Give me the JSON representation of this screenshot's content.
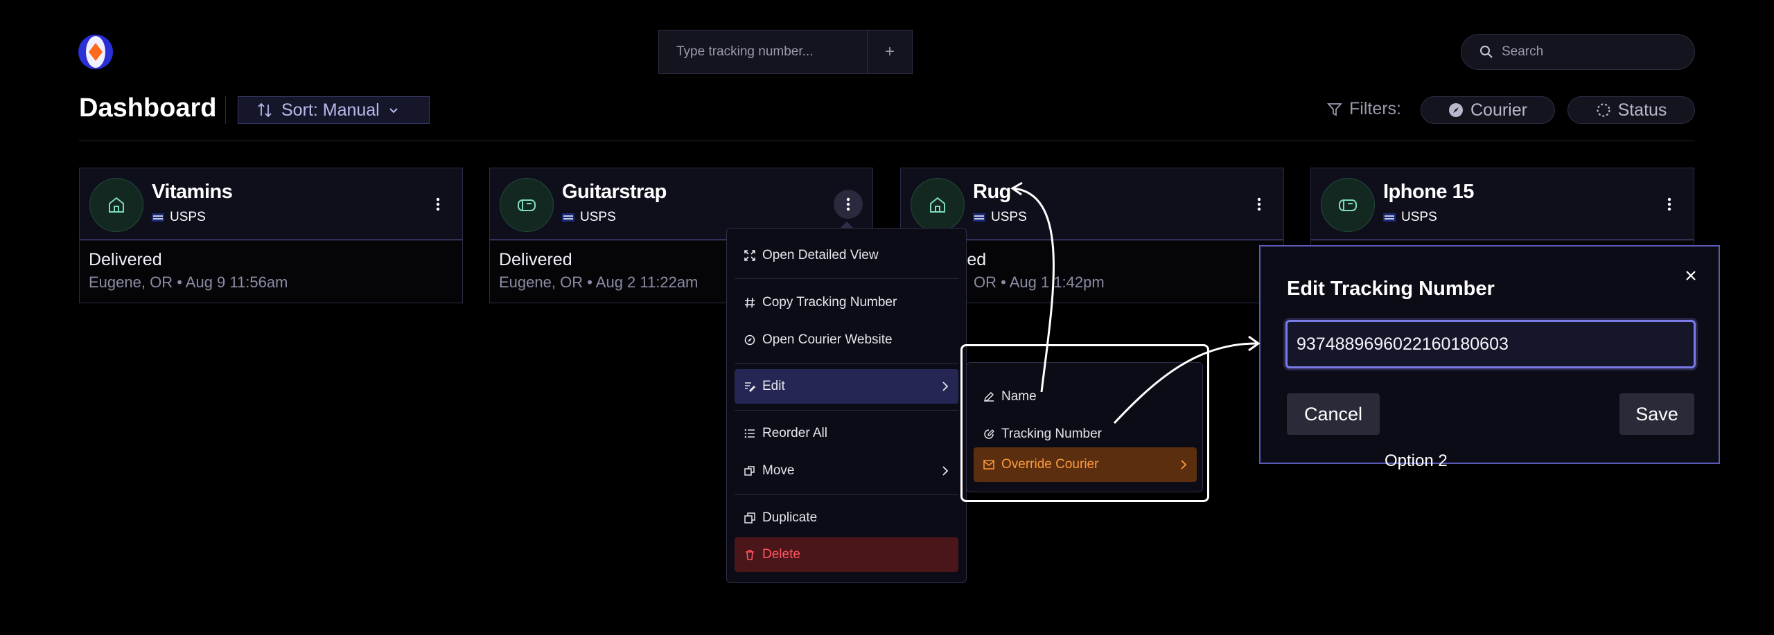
{
  "header": {
    "tracking_placeholder": "Type tracking number...",
    "add_symbol": "+",
    "search_placeholder": "Search"
  },
  "toolbar": {
    "title": "Dashboard",
    "sort_label": "Sort: Manual",
    "filters_label": "Filters:",
    "filter_courier": "Courier",
    "filter_status": "Status"
  },
  "cards": [
    {
      "name": "Vitamins",
      "courier": "USPS",
      "icon": "home-icon",
      "status": "Delivered",
      "location": "Eugene, OR • Aug 9 11:56am"
    },
    {
      "name": "Guitarstrap",
      "courier": "USPS",
      "icon": "mailbox-icon",
      "status": "Delivered",
      "location": "Eugene, OR • Aug 2 11:22am"
    },
    {
      "name": "Rug",
      "courier": "USPS",
      "icon": "home-icon",
      "status": "red",
      "location": "OR • Aug 1 1:42pm"
    },
    {
      "name": "Iphone 15",
      "courier": "USPS",
      "icon": "mailbox-icon",
      "status": "",
      "location": ""
    }
  ],
  "context_menu": {
    "open_detailed_view": "Open Detailed View",
    "copy_tracking_number": "Copy Tracking Number",
    "open_courier_website": "Open Courier Website",
    "edit": "Edit",
    "reorder_all": "Reorder All",
    "move": "Move",
    "duplicate": "Duplicate",
    "delete": "Delete"
  },
  "edit_submenu": {
    "name": "Name",
    "tracking_number": "Tracking Number",
    "override_courier": "Override Courier"
  },
  "modal": {
    "title": "Edit Tracking Number",
    "tracking_value": "9374889696022160180603",
    "cancel": "Cancel",
    "save": "Save"
  },
  "annotation": {
    "caption": "Option 2"
  },
  "colors": {
    "background": "#000000",
    "accent": "#7b7bea",
    "edit_highlight": "#262654",
    "delete_bg": "#4a161a",
    "delete_text": "#ff5560",
    "override_bg": "#5a2e0e",
    "override_text": "#ff9b3d"
  }
}
